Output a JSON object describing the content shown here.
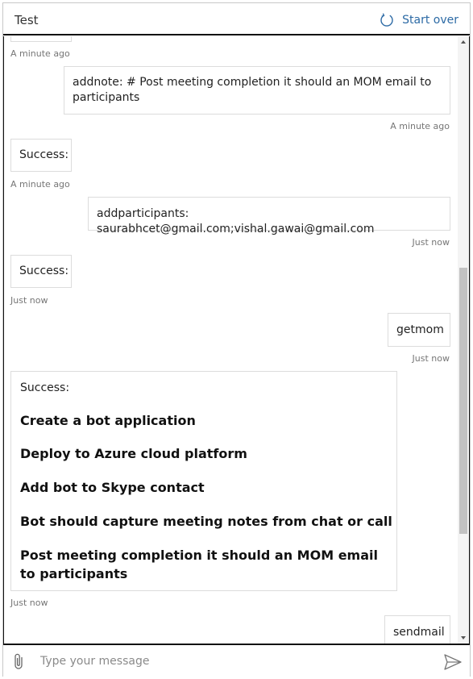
{
  "header": {
    "title": "Test",
    "start_over_label": "Start over"
  },
  "messages": [
    {
      "from": "bot",
      "text": "",
      "timestamp": "A minute ago"
    },
    {
      "from": "user",
      "text": "addnote: # Post meeting completion it should an MOM email to participants",
      "timestamp": "A minute ago"
    },
    {
      "from": "bot",
      "text": "Success:",
      "timestamp": "A minute ago"
    },
    {
      "from": "user",
      "text": "addparticipants: saurabhcet@gmail.com;vishal.gawai@gmail.com",
      "timestamp": "Just now"
    },
    {
      "from": "bot",
      "text": "Success:",
      "timestamp": "Just now"
    },
    {
      "from": "user",
      "text": "getmom",
      "timestamp": "Just now"
    },
    {
      "from": "bot",
      "text": "Success:",
      "items": [
        "Create a bot application",
        "Deploy to Azure cloud platform",
        "Add bot to Skype contact",
        "Bot should capture meeting notes from chat or call",
        "Post meeting completion it should an MOM email to participants"
      ],
      "timestamp": "Just now"
    },
    {
      "from": "user",
      "text": "sendmail",
      "timestamp": ""
    }
  ],
  "composer": {
    "placeholder": "Type your message",
    "value": ""
  },
  "colors": {
    "accent": "#2c6aa5",
    "bubble_border": "#dcdcdc",
    "timestamp": "#767676"
  },
  "icons": {
    "start_over": "refresh-icon",
    "attach": "paperclip-icon",
    "send": "send-icon"
  }
}
